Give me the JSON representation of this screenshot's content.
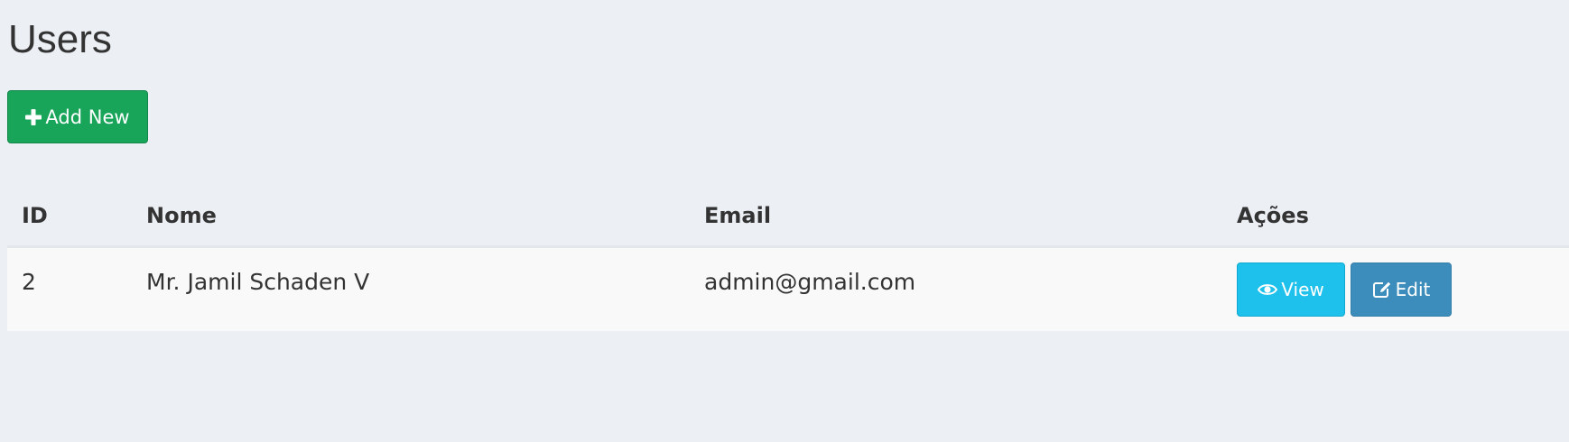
{
  "page": {
    "title": "Users"
  },
  "toolbar": {
    "add_label": "Add New",
    "add_icon": "plus-icon",
    "add_color": "#18a55a"
  },
  "table": {
    "columns": [
      "ID",
      "Nome",
      "Email",
      "Ações"
    ],
    "rows": [
      {
        "id": "2",
        "nome": "Mr. Jamil Schaden V",
        "email": "admin@gmail.com",
        "actions": {
          "view_label": "View",
          "view_icon": "eye-icon",
          "view_color": "#1ec1eb",
          "edit_label": "Edit",
          "edit_icon": "edit-icon",
          "edit_color": "#3c8dbc"
        }
      }
    ]
  }
}
